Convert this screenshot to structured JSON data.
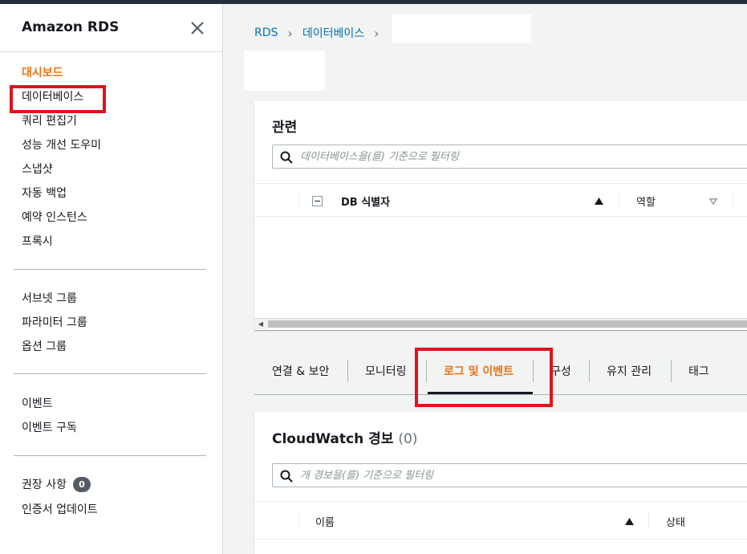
{
  "sidebar": {
    "title": "Amazon RDS",
    "close_icon": "close-icon",
    "group1": [
      "대시보드",
      "데이터베이스",
      "쿼리 편집기",
      "성능 개선 도우미",
      "스냅샷",
      "자동 백업",
      "예약 인스턴스",
      "프록시"
    ],
    "group2": [
      "서브넷 그룹",
      "파라미터 그룹",
      "옵션 그룹"
    ],
    "group3": [
      "이벤트",
      "이벤트 구독"
    ],
    "group4": [
      "권장 사항",
      "인증서 업데이트"
    ],
    "recommendations_count": "0"
  },
  "breadcrumb": {
    "items": [
      "RDS",
      "데이터베이스"
    ]
  },
  "related": {
    "title": "관련",
    "search_placeholder": "데이터베이스을(를) 기준으로 필터링",
    "columns": [
      "DB 식별자",
      "역할"
    ]
  },
  "tabs": {
    "items": [
      "연결 & 보안",
      "모니터링",
      "로그 및 이벤트",
      "구성",
      "유지 관리",
      "태그"
    ],
    "active": "로그 및 이벤트"
  },
  "cloudwatch": {
    "title": "CloudWatch 경보",
    "count": "(0)",
    "search_placeholder": "개 경보을(를) 기준으로 필터링",
    "columns": [
      "이름",
      "상태"
    ]
  },
  "colors": {
    "accent": "#ec7211",
    "link": "#0073bb",
    "highlight": "#e0131f"
  }
}
